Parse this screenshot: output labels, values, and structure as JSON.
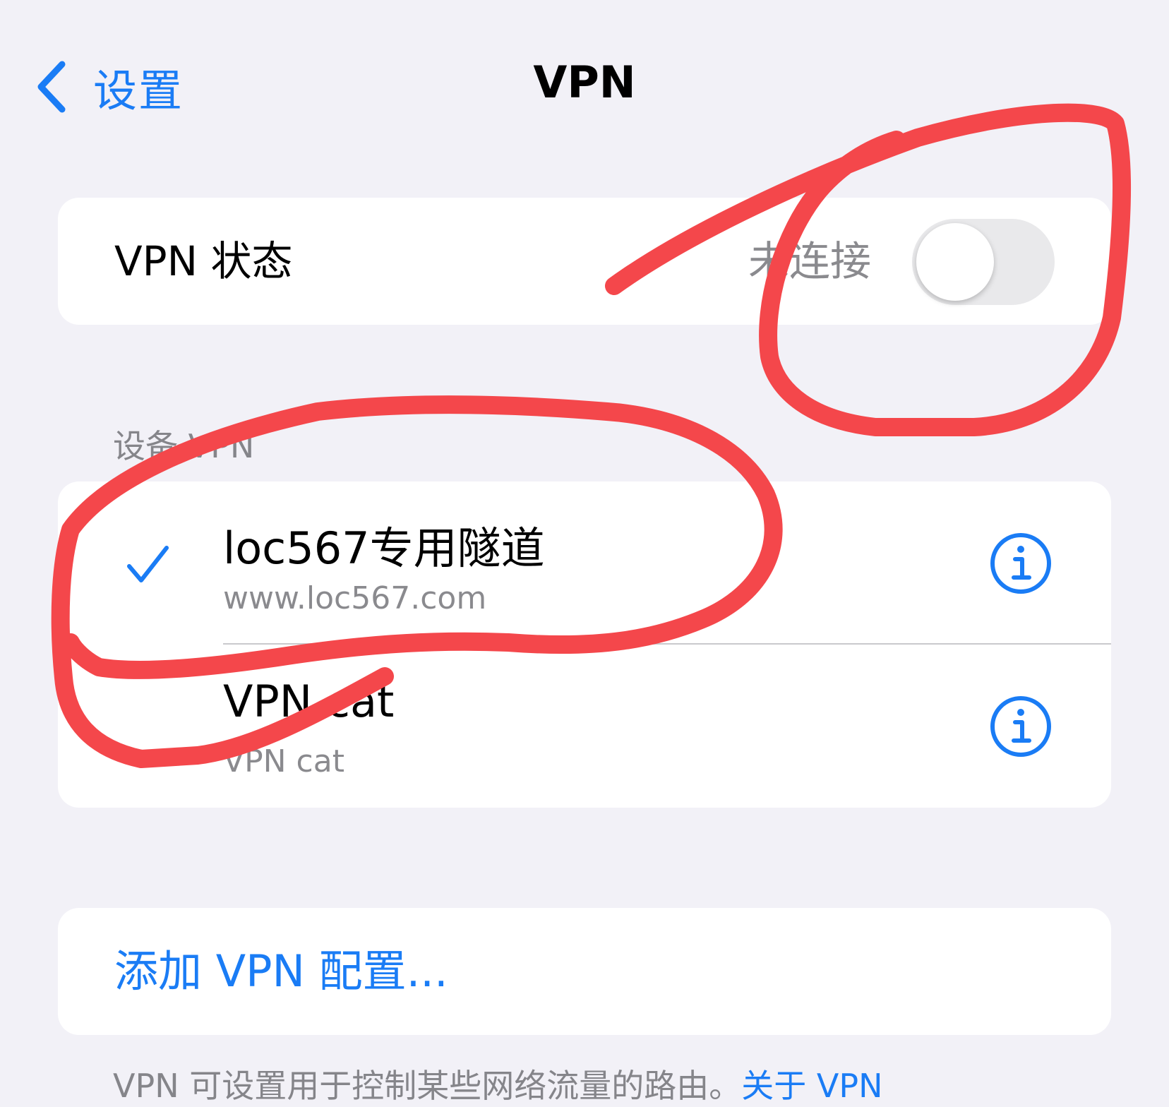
{
  "nav": {
    "back_label": "设置",
    "title": "VPN"
  },
  "status": {
    "label": "VPN 状态",
    "value": "未连接",
    "toggle_on": false
  },
  "device_vpn": {
    "header": "设备 VPN",
    "items": [
      {
        "name": "loc567专用隧道",
        "subtitle": "www.loc567.com",
        "selected": true
      },
      {
        "name": "VPN cat",
        "subtitle": "VPN cat",
        "selected": false
      }
    ]
  },
  "add": {
    "label": "添加 VPN 配置..."
  },
  "footer": {
    "note": "VPN 可设置用于控制某些网络流量的路由。",
    "link": "关于 VPN"
  },
  "colors": {
    "accent": "#1a7cf5",
    "annotation": "#f4474b",
    "background": "#f2f1f7"
  },
  "icons": {
    "back": "chevron-left-icon",
    "selected": "checkmark-icon",
    "info": "info-circle-icon"
  }
}
